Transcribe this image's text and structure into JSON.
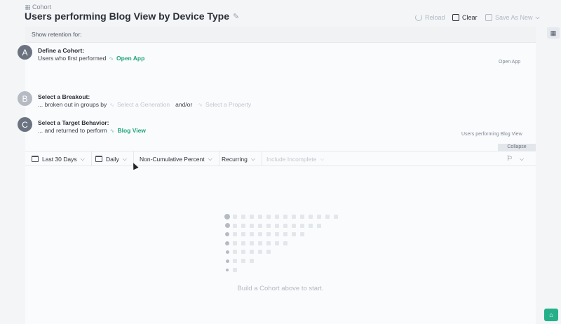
{
  "header": {
    "breadcrumb": "Cohort",
    "title": "Users performing Blog View by Device Type",
    "reload_label": "Reload",
    "clear_label": "Clear",
    "save_label": "Save As New"
  },
  "retention": {
    "show_label": "Show retention for:"
  },
  "steps": [
    {
      "badge": "A",
      "heading": "Define a Cohort:",
      "text": "Users who first performed",
      "event": "Open App",
      "right_label": "Open App"
    },
    {
      "badge": "B",
      "heading": "Select a Breakout:",
      "text": "... broken out in groups by",
      "option1": "Select a Generation",
      "connector": "and/or",
      "option2": "Select a Property"
    },
    {
      "badge": "C",
      "heading": "Select a Target Behavior:",
      "text": "... and returned to perform",
      "event": "Blog View",
      "right_label": "Users performing Blog View"
    }
  ],
  "collapse_label": "Collapse",
  "toolbar": {
    "date_range": "Last 30 Days",
    "interval": "Daily",
    "metric": "Non-Cumulative Percent",
    "mode": "Recurring",
    "incomplete": "Include Incomplete"
  },
  "empty_state": "Build a Cohort above to start.",
  "icons": {
    "breadcrumb": "grid-icon",
    "edit": "pencil-icon",
    "reload": "reload-icon",
    "clear": "clear-icon",
    "save": "save-icon",
    "calendar": "calendar-icon",
    "flag": "flag-icon",
    "table": "table-icon",
    "help": "help-icon"
  },
  "colors": {
    "accent": "#1fa37c",
    "badge_active": "#6c7380",
    "badge_inactive": "#b5bac3"
  }
}
